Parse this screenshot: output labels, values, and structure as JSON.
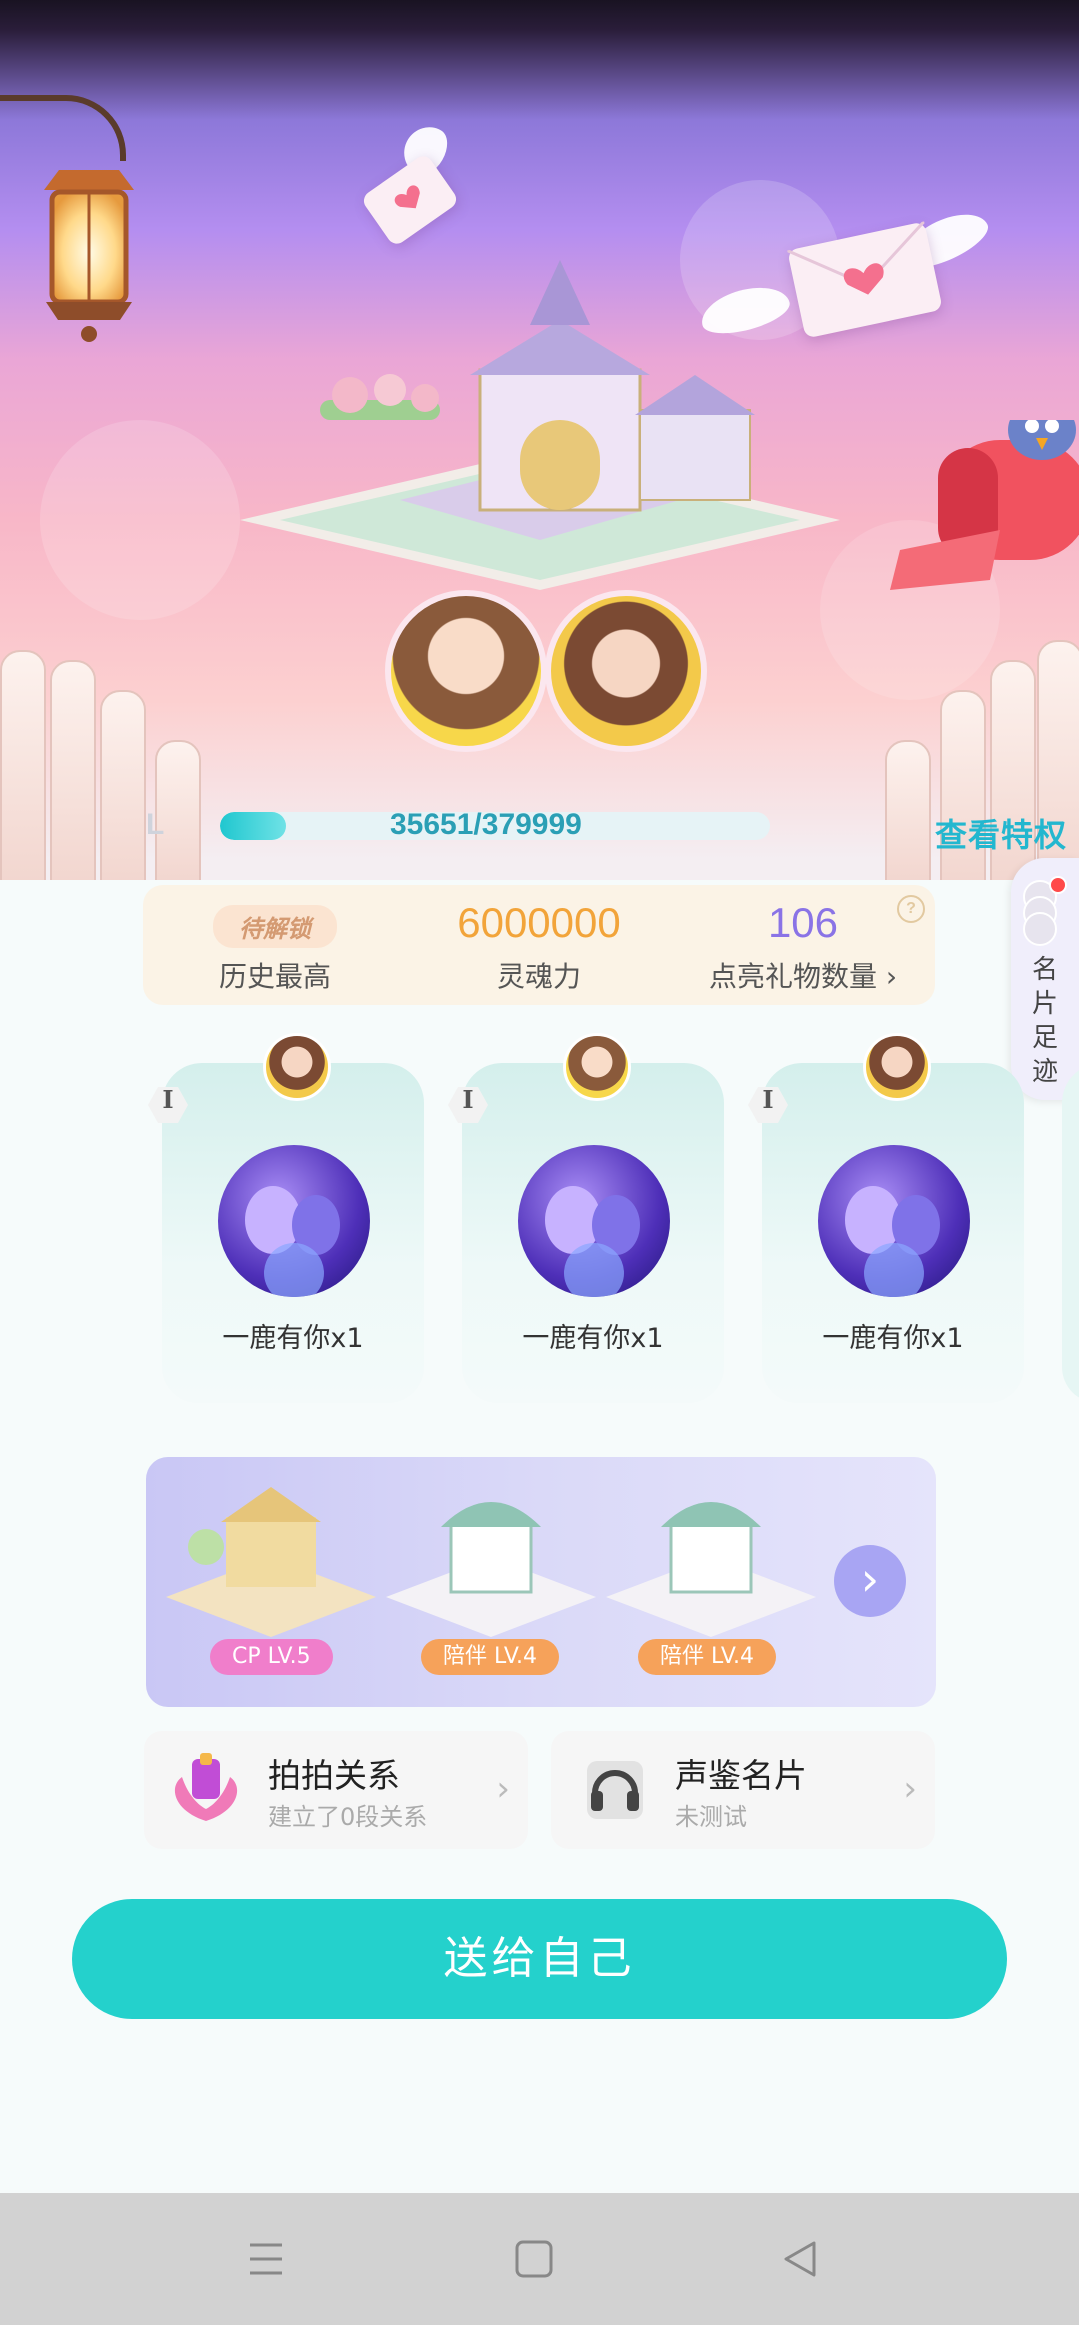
{
  "progress": {
    "level_label": "L",
    "text": "35651/379999",
    "fraction": 0.094,
    "link": "查看特权"
  },
  "stats": [
    {
      "value_badge": "待解锁",
      "label": "历史最高"
    },
    {
      "value": "6000000",
      "label": "灵魂力",
      "color": "#f2a43a"
    },
    {
      "value": "106",
      "label": "点亮礼物数量 ›",
      "color": "#8a73e6"
    }
  ],
  "stats_help": "?",
  "side_tab": {
    "label": "名片足迹"
  },
  "gifts": [
    {
      "level": "I",
      "label": "一鹿有你x1"
    },
    {
      "level": "I",
      "label": "一鹿有你x1"
    },
    {
      "level": "I",
      "label": "一鹿有你x1"
    }
  ],
  "relations": [
    {
      "tag": "CP LV.5",
      "color": "#f07ecb"
    },
    {
      "tag": "陪伴 LV.4",
      "color": "#f6a25a"
    },
    {
      "tag": "陪伴 LV.4",
      "color": "#f6a25a"
    }
  ],
  "relations_next": "›",
  "cards": {
    "paipai": {
      "title": "拍拍关系",
      "subtitle": "建立了0段关系"
    },
    "voice": {
      "title": "声鉴名片",
      "subtitle": "未测试"
    }
  },
  "cta": "送给自己"
}
